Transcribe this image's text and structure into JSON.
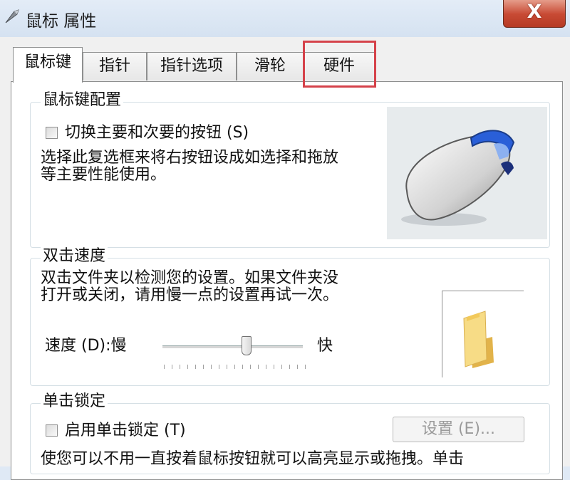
{
  "window": {
    "title": "鼠标 属性",
    "close_label": "X"
  },
  "tabs": [
    {
      "label": "鼠标键",
      "active": true
    },
    {
      "label": "指针",
      "active": false
    },
    {
      "label": "指针选项",
      "active": false
    },
    {
      "label": "滑轮",
      "active": false
    },
    {
      "label": "硬件",
      "active": false,
      "highlighted": true
    }
  ],
  "button_config": {
    "title": "鼠标键配置",
    "checkbox_label": "切换主要和次要的按钮 (S)",
    "checked": false,
    "description_line1": "选择此复选框来将右按钮设成如选择和拖放",
    "description_line2": "等主要性能使用。"
  },
  "double_click": {
    "title": "双击速度",
    "description_line1": "双击文件夹以检测您的设置。如果文件夹没",
    "description_line2": "打开或关闭，请用慢一点的设置再试一次。",
    "speed_label": "速度 (D):慢",
    "fast_label": "快",
    "slider_value_fraction": 0.6
  },
  "click_lock": {
    "title": "单击锁定",
    "checkbox_label": "启用单击锁定 (T)",
    "checked": false,
    "settings_button": "设置 (E)...",
    "description": "使您可以不用一直按着鼠标按钮就可以高亮显示或拖拽。单击"
  },
  "colors": {
    "highlight": "#d5424a",
    "title_bar": "#dae6f3"
  },
  "icons": [
    "mouse-properties-icon",
    "close-icon",
    "mouse-illustration",
    "folder-icon"
  ]
}
